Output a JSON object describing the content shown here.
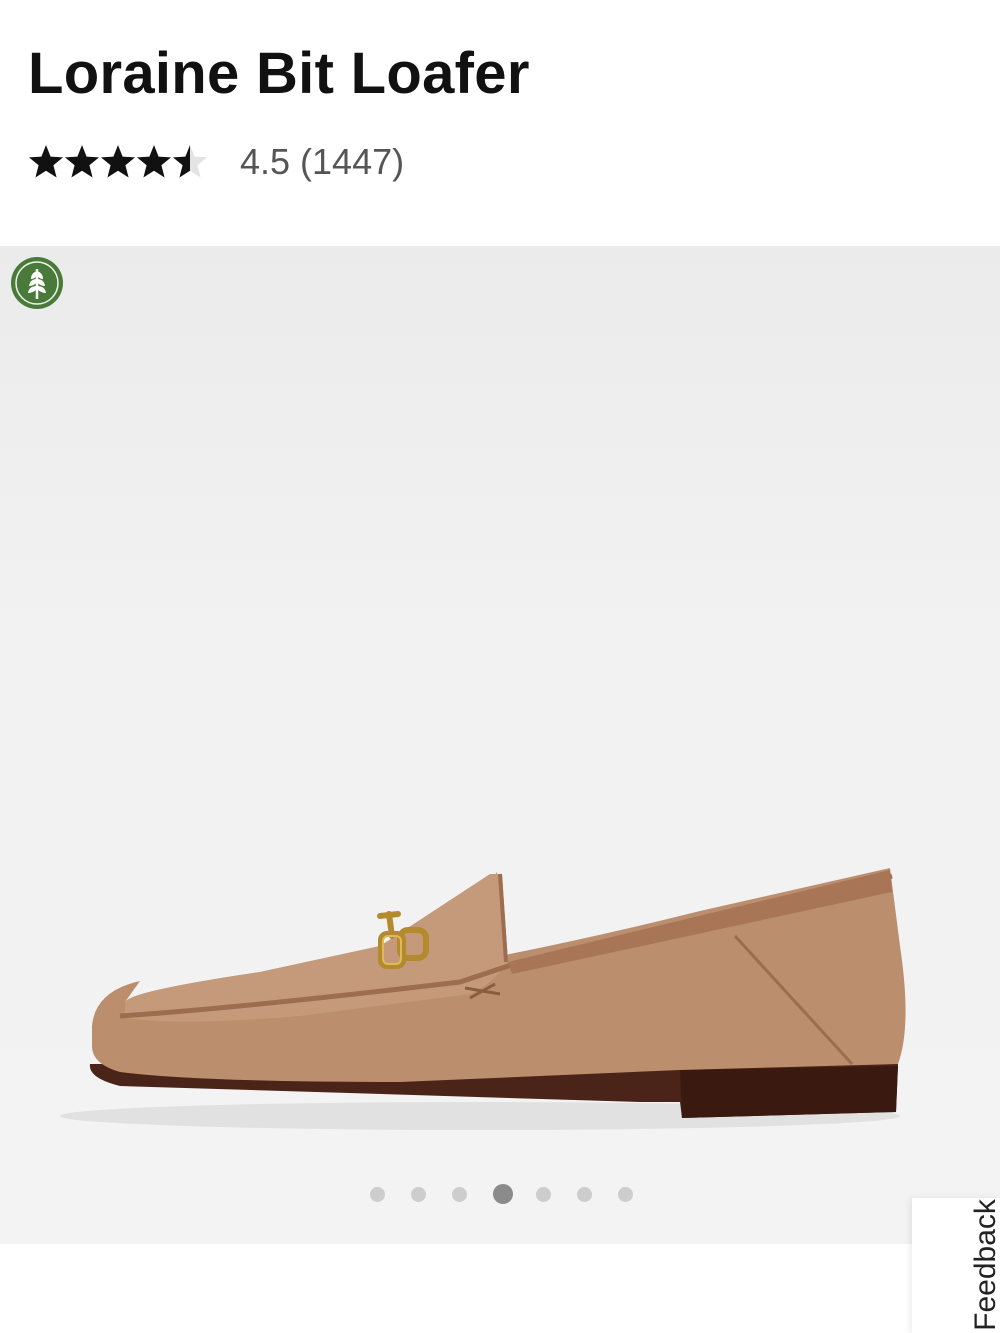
{
  "product": {
    "title": "Loraine Bit Loafer",
    "rating": 4.5,
    "rating_label": "4.5 (1447)",
    "star_color": "#111111",
    "empty_star_color": "#e3e3e3"
  },
  "gallery": {
    "badge_icon": "leaf-badge-icon",
    "badge_color": "#4a7a3a",
    "background_color": "#efefef",
    "dot_count": 7,
    "active_dot": 4
  },
  "feedback": {
    "label": "Feedback"
  }
}
